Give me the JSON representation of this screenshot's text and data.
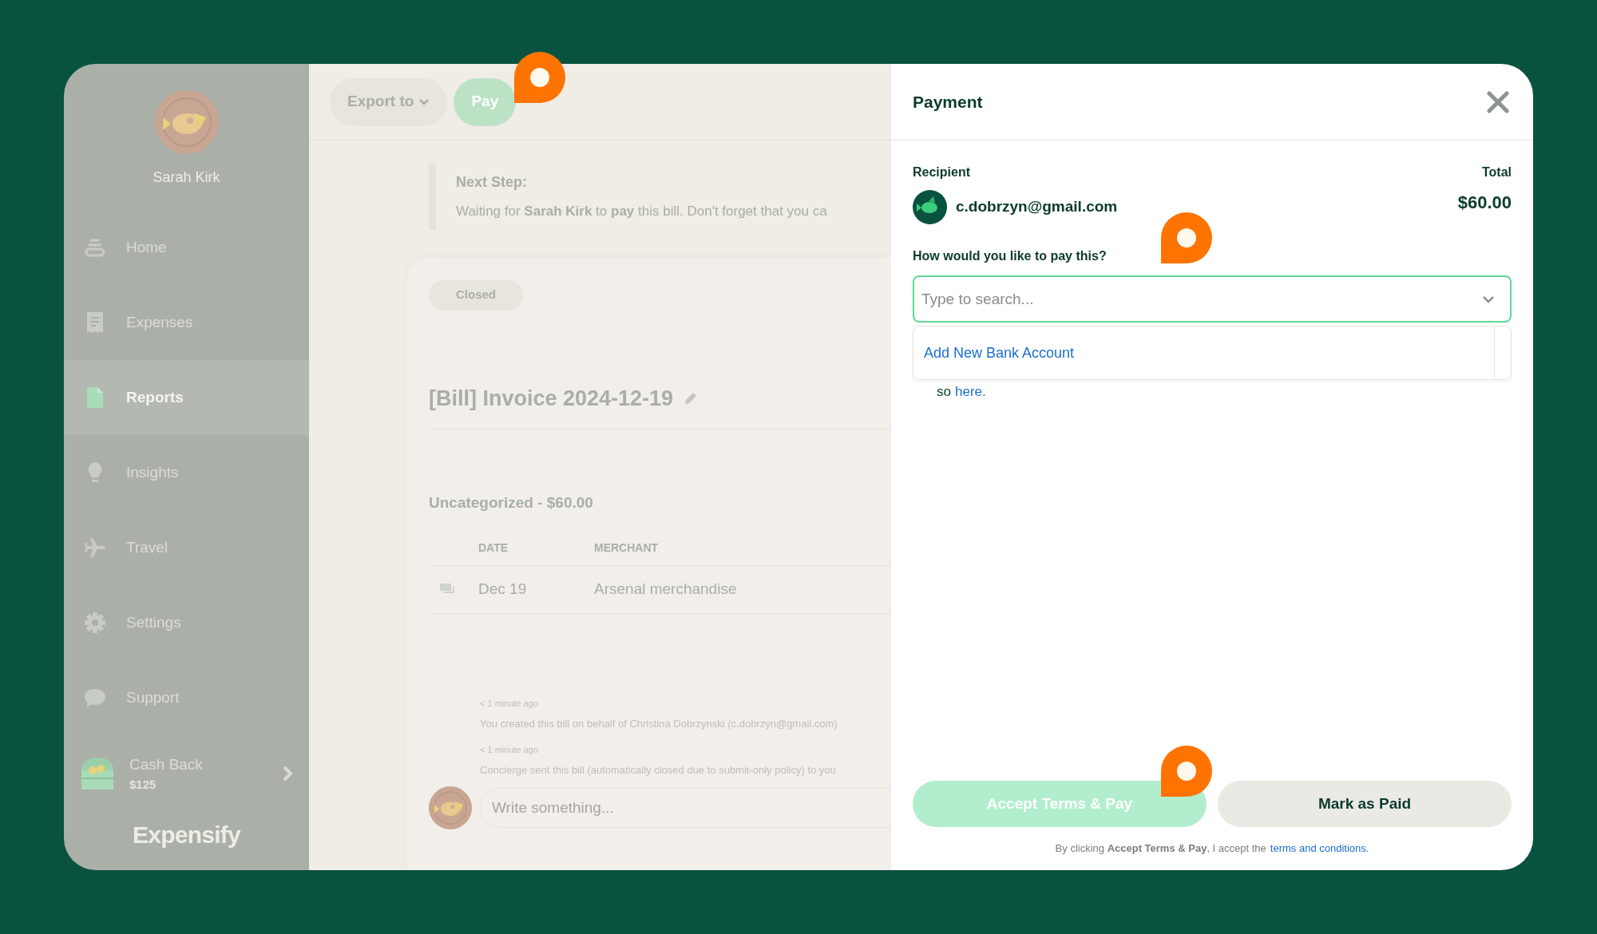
{
  "sidebar": {
    "user_name": "Sarah Kirk",
    "items": [
      {
        "label": "Home",
        "kind": "home",
        "selected": false
      },
      {
        "label": "Expenses",
        "kind": "expenses",
        "selected": false
      },
      {
        "label": "Reports",
        "kind": "reports",
        "selected": true
      },
      {
        "label": "Insights",
        "kind": "insights",
        "selected": false
      },
      {
        "label": "Travel",
        "kind": "travel",
        "selected": false
      },
      {
        "label": "Settings",
        "kind": "settings",
        "selected": false
      },
      {
        "label": "Support",
        "kind": "support",
        "selected": false
      }
    ],
    "cash_back": {
      "label": "Cash Back",
      "amount": "$125"
    },
    "logo": "Expensify"
  },
  "toolbar": {
    "buttons": [
      {
        "label": "Export to",
        "kind": "dropdown"
      },
      {
        "label": "Pay",
        "kind": "primary"
      }
    ]
  },
  "next_step": {
    "title": "Next Step:",
    "text": "Waiting for **Sarah Kirk** to **pay** this bill. Don't forget that you ca"
  },
  "report": {
    "status": "Closed",
    "title": "[Bill] Invoice 2024-12-19",
    "group": "Uncategorized - $60.00",
    "columns": [
      "DATE",
      "MERCHANT"
    ],
    "rows": [
      {
        "date": "Dec 19",
        "merchant": "Arsenal merchandise"
      }
    ]
  },
  "history": [
    {
      "time": "< 1 minute ago",
      "text": "You created this bill on behalf of Christina Dobrzynski (c.dobrzyn@gmail.com)"
    },
    {
      "time": "< 1 minute ago",
      "text": "Concierge sent this bill (automatically closed due to submit-only policy) to you"
    }
  ],
  "comment": {
    "placeholder": "Write something..."
  },
  "payment": {
    "title": "Payment",
    "recipient_label": "Recipient",
    "recipient": "c.dobrzyn@gmail.com",
    "total_label": "Total",
    "total": "$60.00",
    "question": "How would you like to pay this?",
    "search_placeholder": "Type to search...",
    "options": [
      "Add New Bank Account"
    ],
    "hidden_text": "so",
    "hidden_link": "here.",
    "buttons": [
      {
        "label": "Accept Terms & Pay",
        "kind": "primary"
      },
      {
        "label": "Mark as Paid",
        "kind": "secondary"
      }
    ],
    "terms_text": "By clicking **Accept Terms & Pay**, I accept the",
    "terms_link": "terms and conditions."
  }
}
